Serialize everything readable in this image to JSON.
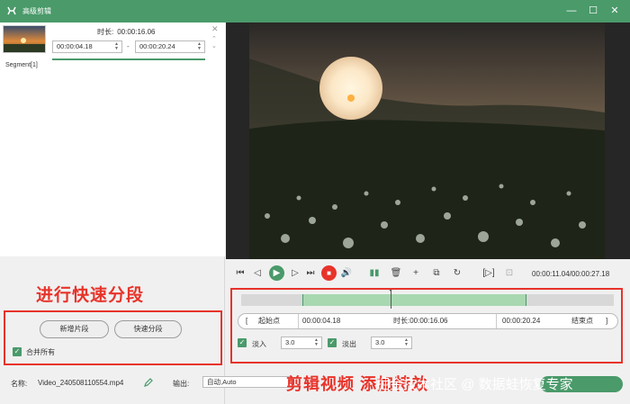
{
  "window": {
    "title": "高级剪辑",
    "accent": "#4a9a6a",
    "controls": [
      "—",
      "☐",
      "✕"
    ]
  },
  "segments": [
    {
      "label": "Segment[1]",
      "duration_label": "时长:",
      "duration": "00:00:16.06",
      "start": "00:00:04.18",
      "dash": "-",
      "end": "00:00:20.24"
    }
  ],
  "annotations": {
    "left": "进行快速分段",
    "right": "剪辑视频 添加特效",
    "color": "#e8332a"
  },
  "left_actions": {
    "new_segment": "新增片段",
    "quick_split": "快速分段",
    "merge_all": "合并所有"
  },
  "footer": {
    "name_label": "名称:",
    "file_name": "Video_240508110554.mp4",
    "output_label": "输出:",
    "output_value": "自动,Auto"
  },
  "player": {
    "time_current": "00:00:11.04",
    "time_total": "00:00:27.18",
    "time_sep": "/"
  },
  "range": {
    "start_point": "起始点",
    "start_bracket": "[",
    "start_time": "00:00:04.18",
    "duration_label": "时长:",
    "duration": "00:00:16.06",
    "end_time": "00:00:20.24",
    "end_point": "结束点",
    "end_bracket": "]"
  },
  "effects": {
    "fade_in_label": "淡入",
    "fade_in_value": "3.0",
    "fade_out_label": "淡出",
    "fade_out_value": "3.0"
  },
  "watermark": "掘金技术社区 @ 数据蛙恢复专家"
}
